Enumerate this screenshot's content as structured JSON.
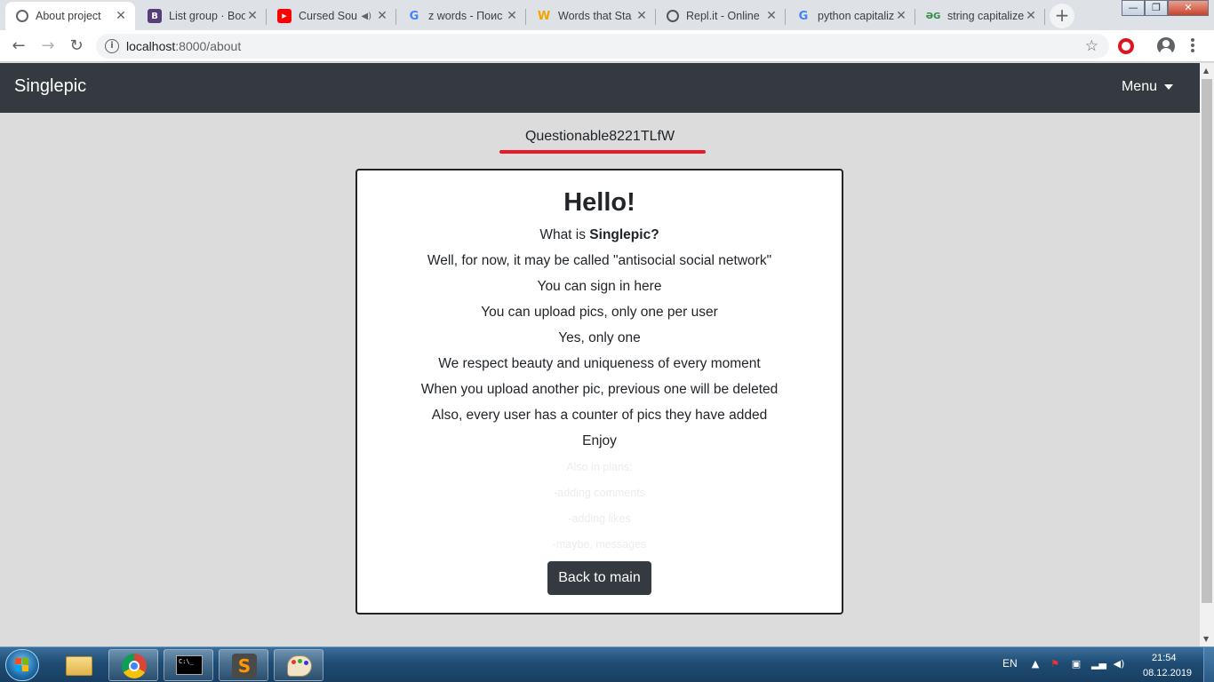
{
  "browser": {
    "tabs": [
      {
        "title": "About project",
        "icon": "chrome-globe-icon",
        "active": true
      },
      {
        "title": "List group · Boo",
        "icon": "bootstrap-icon"
      },
      {
        "title": "Cursed Sou",
        "icon": "youtube-icon",
        "audio": true
      },
      {
        "title": "z words - Поис",
        "icon": "google-icon"
      },
      {
        "title": "Words that Sta",
        "icon": "w-icon"
      },
      {
        "title": "Repl.it - Online",
        "icon": "replit-icon"
      },
      {
        "title": "python capitaliz",
        "icon": "google-icon"
      },
      {
        "title": "string capitalize",
        "icon": "geeksforgeeks-icon"
      }
    ],
    "address": {
      "host": "localhost",
      "rest": ":8000/about"
    },
    "colors": {
      "accent": "#e81a2a",
      "navbar": "#343a40"
    }
  },
  "page": {
    "brand": "Singlepic",
    "menu_label": "Menu",
    "username": "Questionable8221TLfW",
    "heading": "Hello!",
    "what_is_prefix": "What is ",
    "what_is_bold": "Singlepic?",
    "lines": [
      "Well, for now, it may be called \"antisocial social network\"",
      "You can sign in here",
      "You can upload pics, only one per user",
      "Yes, only one",
      "We respect beauty and uniqueness of every moment",
      "When you upload another pic, previous one will be deleted",
      "Also, every user has a counter of pics they have added",
      "Enjoy"
    ],
    "faint_lines": [
      "Also in plans:",
      "-adding comments",
      "-adding likes",
      "-maybe, messages"
    ],
    "back_button": "Back to main"
  },
  "taskbar": {
    "lang": "EN",
    "time": "21:54",
    "date": "08.12.2019"
  }
}
